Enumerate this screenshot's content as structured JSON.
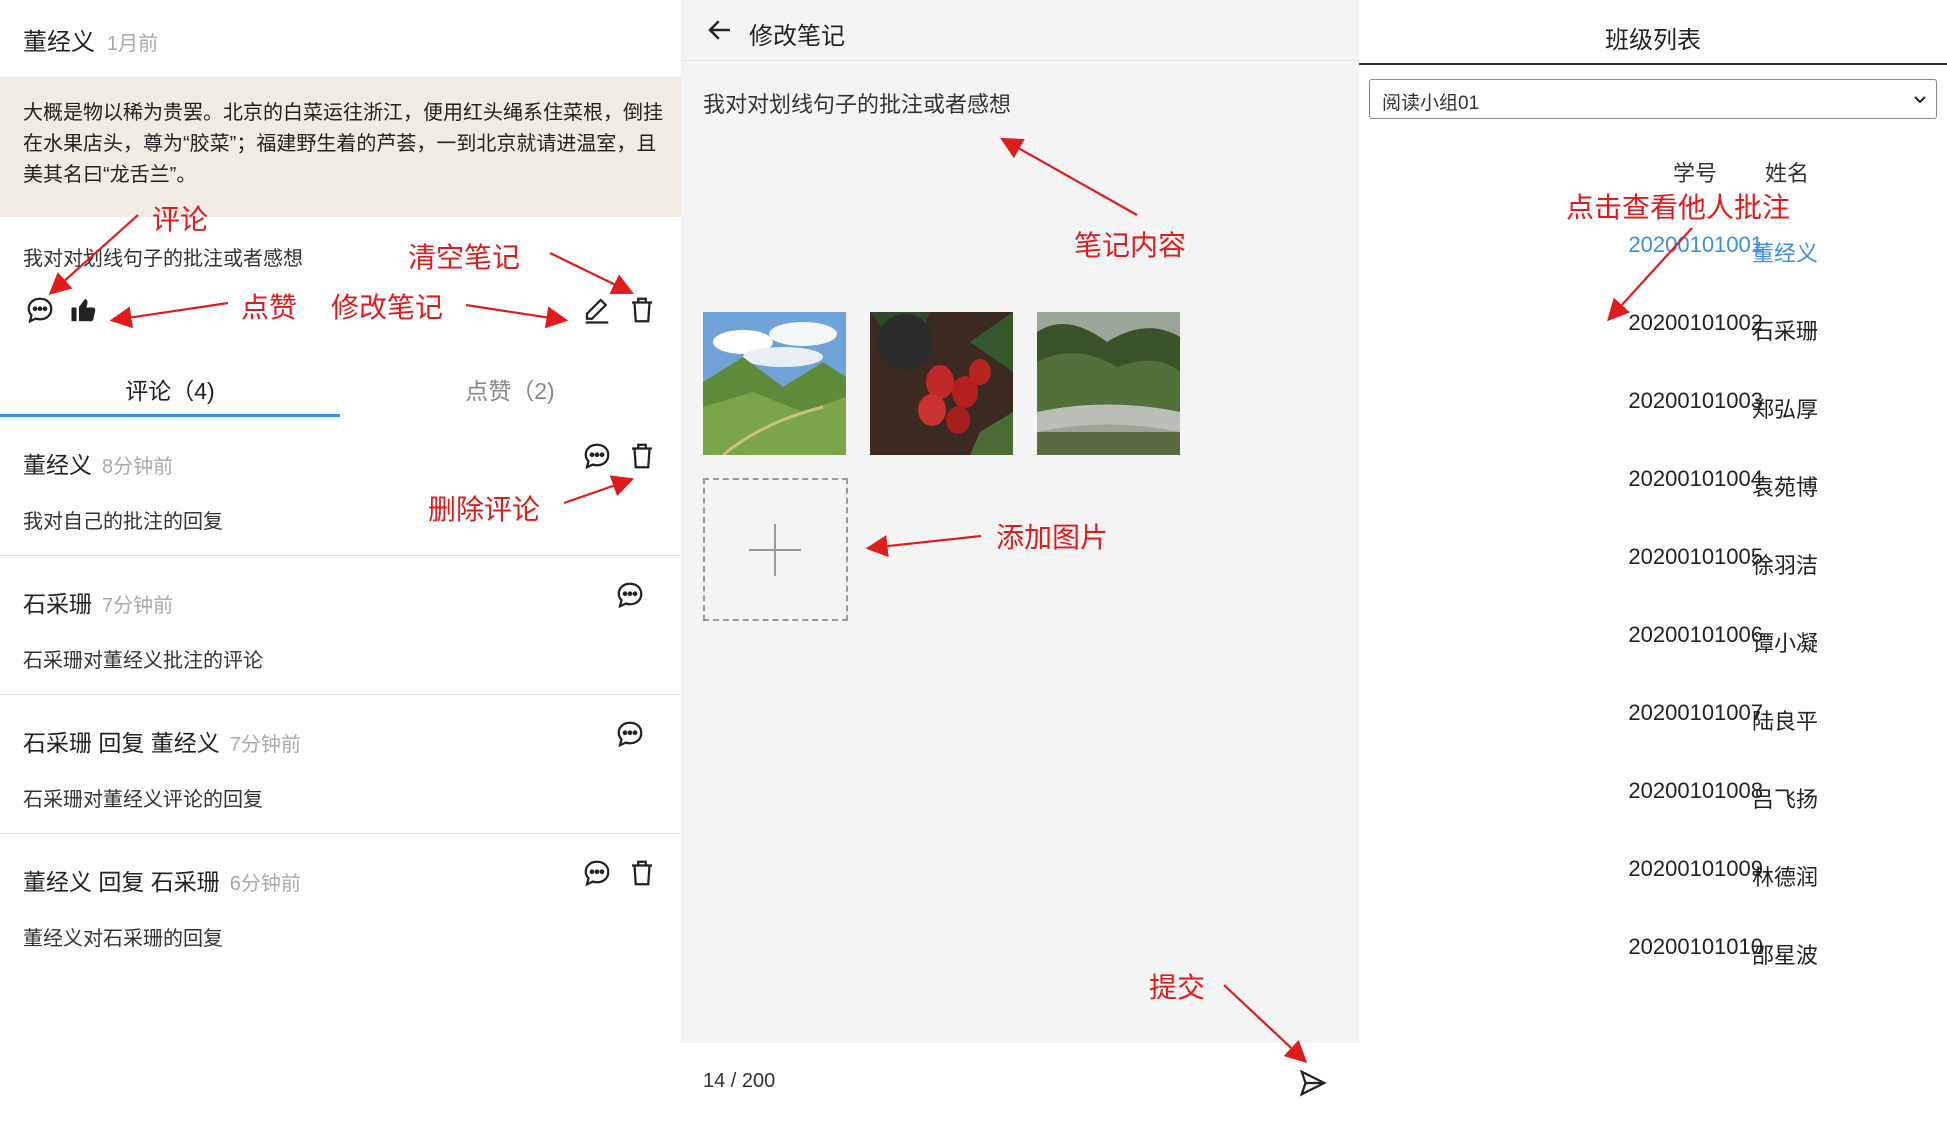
{
  "note": {
    "author": "董经义",
    "time": "1月前",
    "quote": "大概是物以稀为贵罢。北京的白菜运往浙江，便用红头绳系住菜根，倒挂在水果店头，尊为“胶菜”；福建野生着的芦荟，一到北京就请进温室，且美其名曰“龙舌兰”。",
    "text": "我对对划线句子的批注或者感想",
    "tabs": [
      {
        "label": "评论（4)",
        "active": true
      },
      {
        "label": "点赞（2)",
        "active": false
      }
    ],
    "comments": [
      {
        "author": "董经义",
        "time": "8分钟前",
        "body": "我对自己的批注的回复",
        "deletable": true
      },
      {
        "author": "石采珊",
        "time": "7分钟前",
        "body": "石采珊对董经义批注的评论",
        "deletable": false
      },
      {
        "author": "石采珊 回复 董经义",
        "time": "7分钟前",
        "body": "石采珊对董经义评论的回复",
        "deletable": false
      },
      {
        "author": "董经义 回复 石采珊",
        "time": "6分钟前",
        "body": "董经义对石采珊的回复",
        "deletable": true
      }
    ]
  },
  "edit": {
    "title": "修改笔记",
    "content": "我对对划线句子的批注或者感想",
    "images": [
      "mountain-valley-photo",
      "strawberries-photo",
      "forest-river-photo"
    ],
    "counter": "14 / 200"
  },
  "class_list": {
    "title": "班级列表",
    "selected_group": "阅读小组01",
    "headers": {
      "id": "学号",
      "name": "姓名"
    },
    "students": [
      {
        "id": "20200101001",
        "name": "董经义",
        "selected": true
      },
      {
        "id": "20200101002",
        "name": "石采珊"
      },
      {
        "id": "20200101003",
        "name": "郑弘厚"
      },
      {
        "id": "20200101004",
        "name": "袁苑博"
      },
      {
        "id": "20200101005",
        "name": "徐羽洁"
      },
      {
        "id": "20200101006",
        "name": "谭小凝"
      },
      {
        "id": "20200101007",
        "name": "陆良平"
      },
      {
        "id": "20200101008",
        "name": "吕飞扬"
      },
      {
        "id": "20200101009",
        "name": "林德润"
      },
      {
        "id": "20200101010",
        "name": "邵星波"
      }
    ]
  },
  "annotations": {
    "comment": "评论",
    "like": "点赞",
    "clear_note": "清空笔记",
    "edit_note": "修改笔记",
    "delete_comment": "删除评论",
    "note_content": "笔记内容",
    "add_image": "添加图片",
    "submit": "提交",
    "view_others": "点击查看他人批注"
  },
  "colors": {
    "accent": "#3a8fe0",
    "annotation": "#e01b1b",
    "quote_bg": "#f0ece3",
    "panel_bg": "#f4f4f4"
  },
  "icons": [
    "comment-icon",
    "thumbs-up-icon",
    "pencil-icon",
    "trash-icon",
    "back-arrow-icon",
    "plus-icon",
    "send-icon",
    "chevron-down-icon"
  ]
}
